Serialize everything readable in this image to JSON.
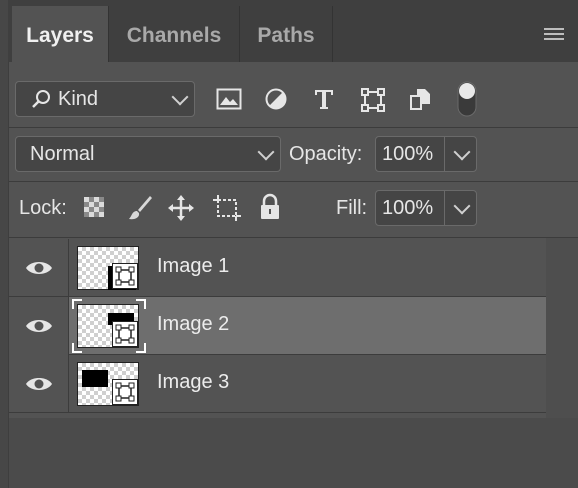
{
  "tabs": [
    {
      "label": "Layers",
      "active": true
    },
    {
      "label": "Channels",
      "active": false
    },
    {
      "label": "Paths",
      "active": false
    }
  ],
  "filter": {
    "kind_label": "Kind",
    "filter_icons": [
      "image-filter-icon",
      "adjustment-filter-icon",
      "type-filter-icon",
      "shape-filter-icon",
      "smart-object-filter-icon",
      "filter-toggle-icon"
    ]
  },
  "blend": {
    "mode": "Normal",
    "opacity_label": "Opacity:",
    "opacity_value": "100%"
  },
  "lock": {
    "label": "Lock:",
    "icons": [
      "lock-transparent-icon",
      "lock-image-icon",
      "lock-position-icon",
      "lock-artboard-icon",
      "lock-all-icon"
    ],
    "fill_label": "Fill:",
    "fill_value": "100%"
  },
  "layers": [
    {
      "name": "Image 1",
      "visible": true,
      "selected": false
    },
    {
      "name": "Image 2",
      "visible": true,
      "selected": true
    },
    {
      "name": "Image 3",
      "visible": true,
      "selected": false
    }
  ],
  "colors": {
    "panel_bg": "#535353",
    "tabbar_bg": "#3f3f3f",
    "selected_row": "#6e6e6e"
  }
}
